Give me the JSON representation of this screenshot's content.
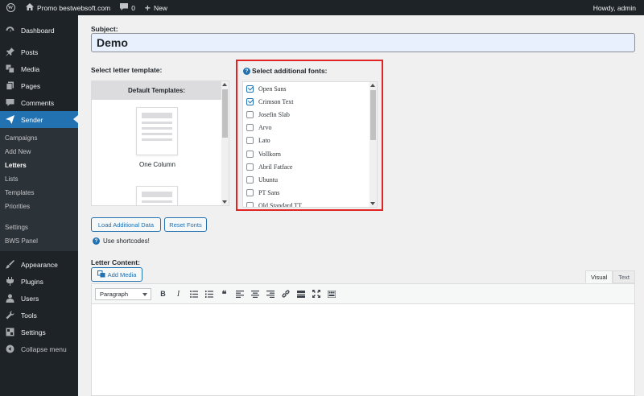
{
  "adminbar": {
    "site_name": "Promo bestwebsoft.com",
    "comments_count": "0",
    "new_label": "New",
    "greeting": "Howdy, admin"
  },
  "sidebar": {
    "top_items": [
      {
        "label": "Dashboard",
        "icon": "dashboard-icon"
      }
    ],
    "items": [
      {
        "label": "Posts",
        "icon": "pin-icon"
      },
      {
        "label": "Media",
        "icon": "media-icon"
      },
      {
        "label": "Pages",
        "icon": "page-icon"
      },
      {
        "label": "Comments",
        "icon": "comment-icon"
      },
      {
        "label": "Sender",
        "icon": "send-icon",
        "active": true
      }
    ],
    "submenu": [
      "Campaigns",
      "Add New",
      "Letters",
      "Lists",
      "Templates",
      "Priorities"
    ],
    "submenu2": [
      "Settings",
      "BWS Panel"
    ],
    "bottom_items": [
      {
        "label": "Appearance",
        "icon": "brush-icon"
      },
      {
        "label": "Plugins",
        "icon": "plugin-icon"
      },
      {
        "label": "Users",
        "icon": "user-icon"
      },
      {
        "label": "Tools",
        "icon": "wrench-icon"
      },
      {
        "label": "Settings",
        "icon": "settings-icon"
      },
      {
        "label": "Collapse menu",
        "icon": "collapse-icon"
      }
    ]
  },
  "form": {
    "subject_label": "Subject:",
    "subject_value": "Demo",
    "template_label": "Select letter template:",
    "template_header": "Default Templates:",
    "template_name": "One Column",
    "fonts_label": "Select additional fonts:",
    "fonts": [
      {
        "name": "Open Sans",
        "checked": true
      },
      {
        "name": "Crimson Text",
        "checked": true
      },
      {
        "name": "Josefin Slab",
        "checked": false
      },
      {
        "name": "Arvo",
        "checked": false
      },
      {
        "name": "Lato",
        "checked": false
      },
      {
        "name": "Vollkorn",
        "checked": false
      },
      {
        "name": "Abril Fatface",
        "checked": false
      },
      {
        "name": "Ubuntu",
        "checked": false
      },
      {
        "name": "PT Sans",
        "checked": false
      },
      {
        "name": "Old Standard TT",
        "checked": false
      }
    ],
    "load_button": "Load Additional Data",
    "reset_button": "Reset Fonts",
    "shortcodes": "Use shortcodes!",
    "letter_content_label": "Letter Content:",
    "add_media": "Add Media",
    "tab_visual": "Visual",
    "tab_text": "Text",
    "format_select": "Paragraph"
  }
}
